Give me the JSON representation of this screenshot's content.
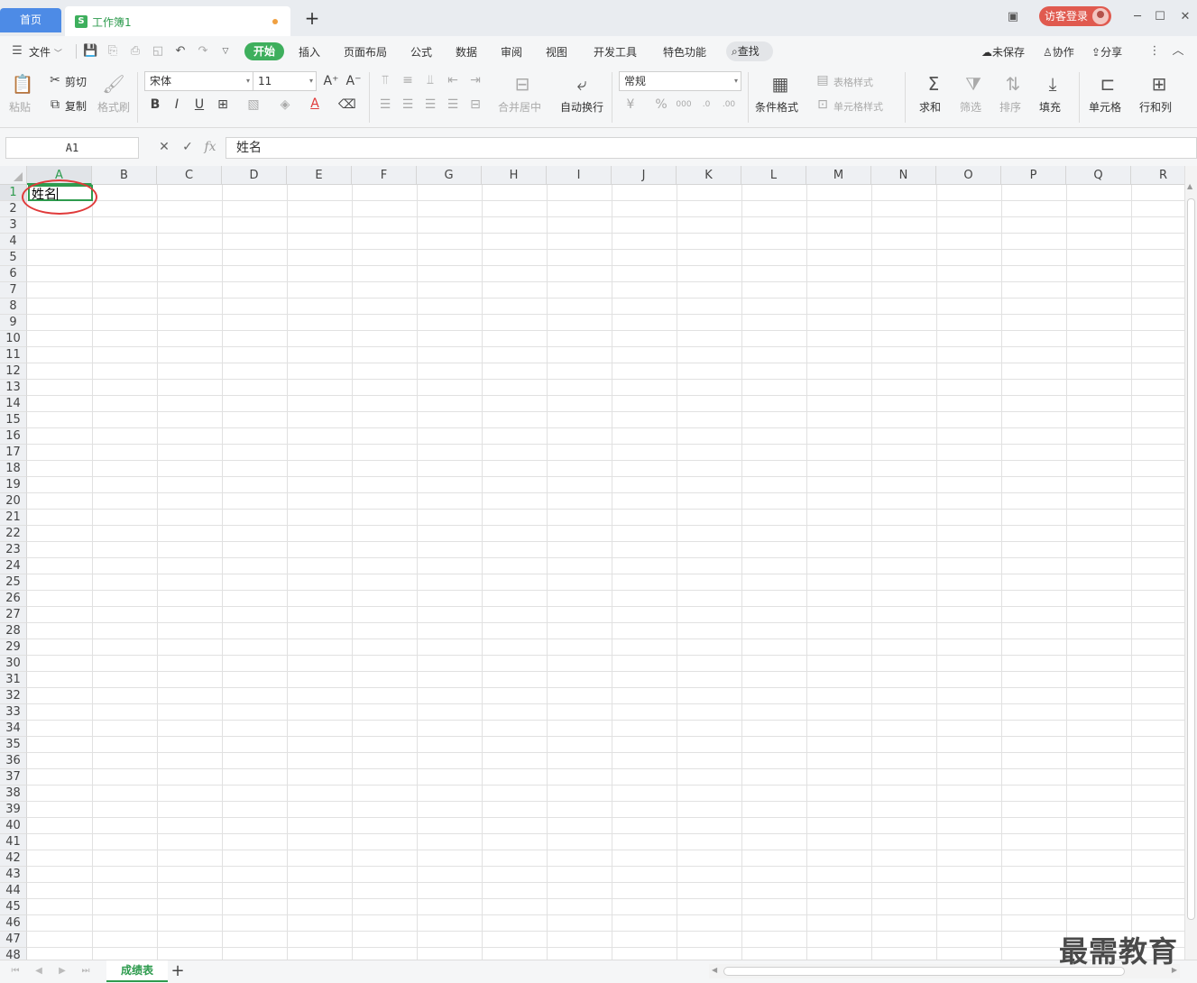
{
  "titlebar": {
    "home_tab": "首页",
    "doc_tab": "工作簿1",
    "doc_icon_letter": "S",
    "login": "访客登录"
  },
  "menu": {
    "file": "文件",
    "tabs": [
      "开始",
      "插入",
      "页面布局",
      "公式",
      "数据",
      "审阅",
      "视图",
      "开发工具",
      "特色功能"
    ],
    "find": "查找",
    "unsaved": "未保存",
    "collab": "协作",
    "share": "分享"
  },
  "ribbon": {
    "paste": "粘贴",
    "cut": "剪切",
    "copy": "复制",
    "format_painter": "格式刷",
    "font_name": "宋体",
    "font_size": "11",
    "merge_center": "合并居中",
    "wrap_text": "自动换行",
    "number_format": "常规",
    "conditional_format": "条件格式",
    "table_style": "表格样式",
    "cell_style": "单元格样式",
    "sum": "求和",
    "filter": "筛选",
    "sort": "排序",
    "fill": "填充",
    "cell": "单元格",
    "row_col": "行和列"
  },
  "formula_bar": {
    "cell_ref": "A1",
    "fx": "fx",
    "content": "姓名"
  },
  "grid": {
    "columns": [
      "A",
      "B",
      "C",
      "D",
      "E",
      "F",
      "G",
      "H",
      "I",
      "J",
      "K",
      "L",
      "M",
      "N",
      "O",
      "P",
      "Q",
      "R"
    ],
    "row_count": 48,
    "selected_col": "A",
    "selected_row": 1,
    "a1_value": "姓名"
  },
  "sheets": {
    "active": "成绩表"
  },
  "watermark": "最需教育",
  "colors": {
    "accent_green": "#3eaf5d",
    "home_blue": "#4d8be6",
    "login_red": "#e05a4f",
    "annotation_red": "#e03a3a"
  }
}
